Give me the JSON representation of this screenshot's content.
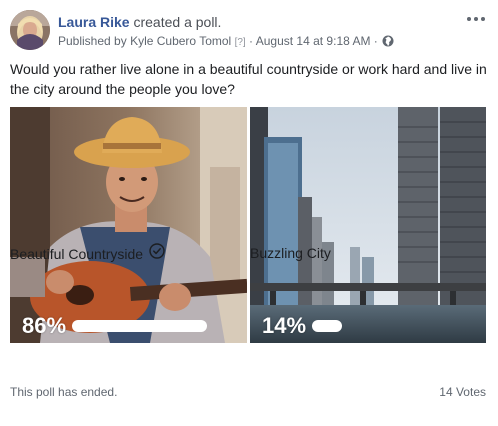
{
  "post": {
    "author_name": "Laura Rike",
    "author_action": "created a poll.",
    "published_prefix": "Published by",
    "publisher_name": "Kyle Cubero Tomol",
    "help_marker": "[?]",
    "separator": " · ",
    "timestamp": "August 14 at 9:18 AM",
    "separator2": " ·",
    "privacy_icon": "globe-icon",
    "more_icon": "ellipsis-icon"
  },
  "poll": {
    "question": "Would you rather live alone in a beautiful countryside or work hard and live in the city around the people you love?",
    "options": [
      {
        "label": "Beautiful Countryside",
        "percent_text": "86%",
        "percent": 86,
        "selected_icon": "check-circle-icon"
      },
      {
        "label": "Buzzling City",
        "percent_text": "14%",
        "percent": 14
      }
    ],
    "status": "This poll has ended.",
    "votes": "14 Votes"
  },
  "colors": {
    "link_blue": "#385898",
    "secondary_text": "#606770",
    "bar": "#ffffff"
  }
}
